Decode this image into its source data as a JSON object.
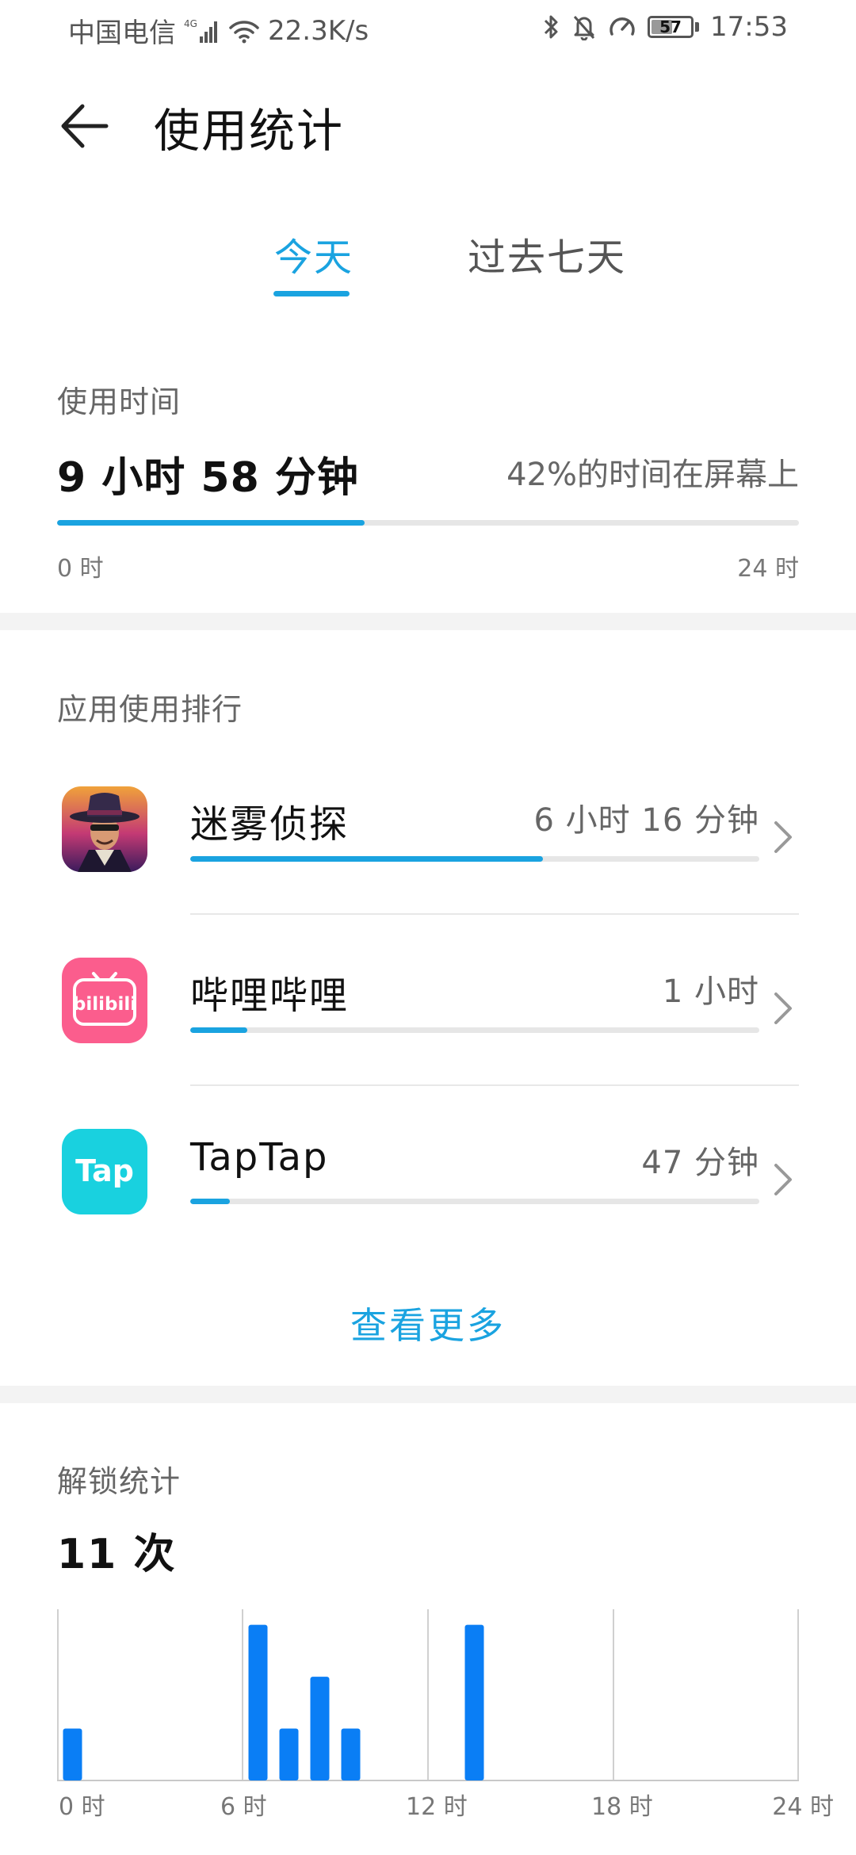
{
  "status_bar": {
    "carrier": "中国电信",
    "network_type": "4G",
    "speed": "22.3K/s",
    "battery": "57",
    "time": "17:53"
  },
  "header": {
    "title": "使用统计"
  },
  "tabs": [
    {
      "label": "今天",
      "selected": true
    },
    {
      "label": "过去七天",
      "selected": false
    }
  ],
  "usage": {
    "label": "使用时间",
    "total": "9 小时 58 分钟",
    "percent_text": "42%的时间在屏幕上",
    "progress_fraction": 0.415,
    "axis_start": "0 时",
    "axis_end": "24 时"
  },
  "ranking": {
    "label": "应用使用排行",
    "apps": [
      {
        "name": "迷雾侦探",
        "time": "6 小时 16 分钟",
        "progress_fraction": 0.62,
        "icon": "detective-app-icon"
      },
      {
        "name": "哔哩哔哩",
        "time": "1 小时",
        "progress_fraction": 0.1,
        "icon": "bilibili-app-icon",
        "icon_text": "bilibili"
      },
      {
        "name": "TapTap",
        "time": "47 分钟",
        "progress_fraction": 0.07,
        "icon": "taptap-app-icon",
        "icon_text": "Tap"
      }
    ],
    "see_more": "查看更多"
  },
  "unlock": {
    "label": "解锁统计",
    "count": "11 次"
  },
  "colors": {
    "accent": "#1aa3e0",
    "bar": "#0a7ef5",
    "track": "#e6e6e6",
    "bilibili": "#fb5d8d",
    "taptap": "#19d1df"
  },
  "chart_data": {
    "type": "bar",
    "title": "",
    "xlabel": "",
    "ylabel": "",
    "x": [
      0.5,
      6.5,
      7.5,
      8.5,
      9.5,
      13.5
    ],
    "values": [
      1,
      3,
      1,
      2,
      1,
      3
    ],
    "xlim": [
      0,
      24
    ],
    "ylim": [
      0,
      3.3
    ],
    "x_ticks": [
      0,
      6,
      12,
      18,
      24
    ],
    "x_tick_labels": [
      "0 时",
      "6 时",
      "12 时",
      "18 时",
      "24 时"
    ],
    "grid": "vertical lines at 6-hour intervals",
    "color": "#0a7ef5"
  }
}
